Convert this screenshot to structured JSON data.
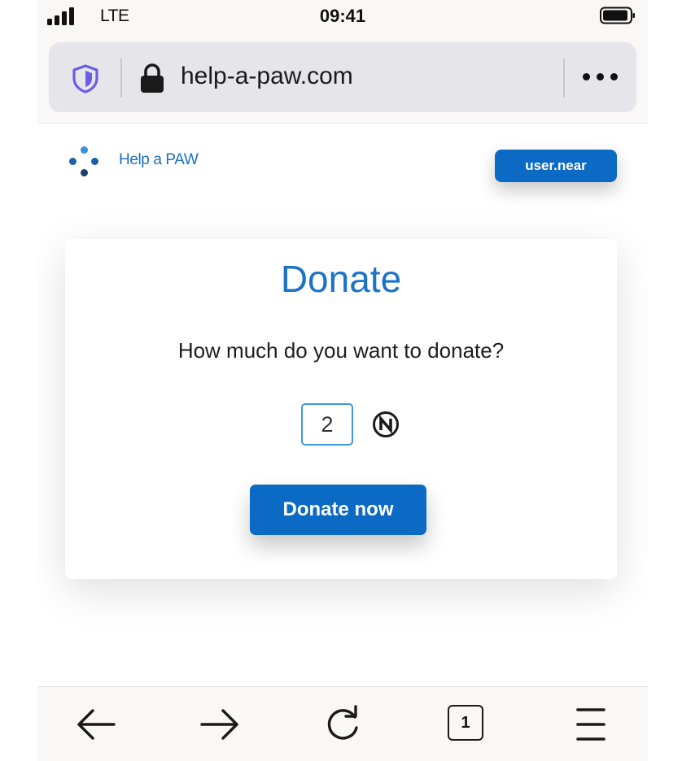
{
  "status_bar": {
    "network": "LTE",
    "time": "09:41",
    "icons": [
      "signal-icon",
      "battery-icon"
    ]
  },
  "browser": {
    "url": "help-a-paw.com",
    "icons": [
      "shield-icon",
      "lock-icon",
      "more-options-icon"
    ]
  },
  "header": {
    "brand": "Help a PAW",
    "account": "user.near"
  },
  "donate_card": {
    "title": "Donate",
    "question": "How much do you want to donate?",
    "amount": "2",
    "currency_icon": "near-icon",
    "button": "Donate now"
  },
  "toolbar": {
    "tabs_count": "1",
    "icons": [
      "back-arrow-icon",
      "forward-arrow-icon",
      "reload-icon",
      "tabs-icon",
      "menu-icon"
    ]
  },
  "colors": {
    "accent": "#0b6ac3",
    "title_blue": "#1b73c9",
    "shield_purple": "#6c5ce7",
    "logo_dark": "#1a3f6b",
    "logo_light": "#3b8ede"
  }
}
